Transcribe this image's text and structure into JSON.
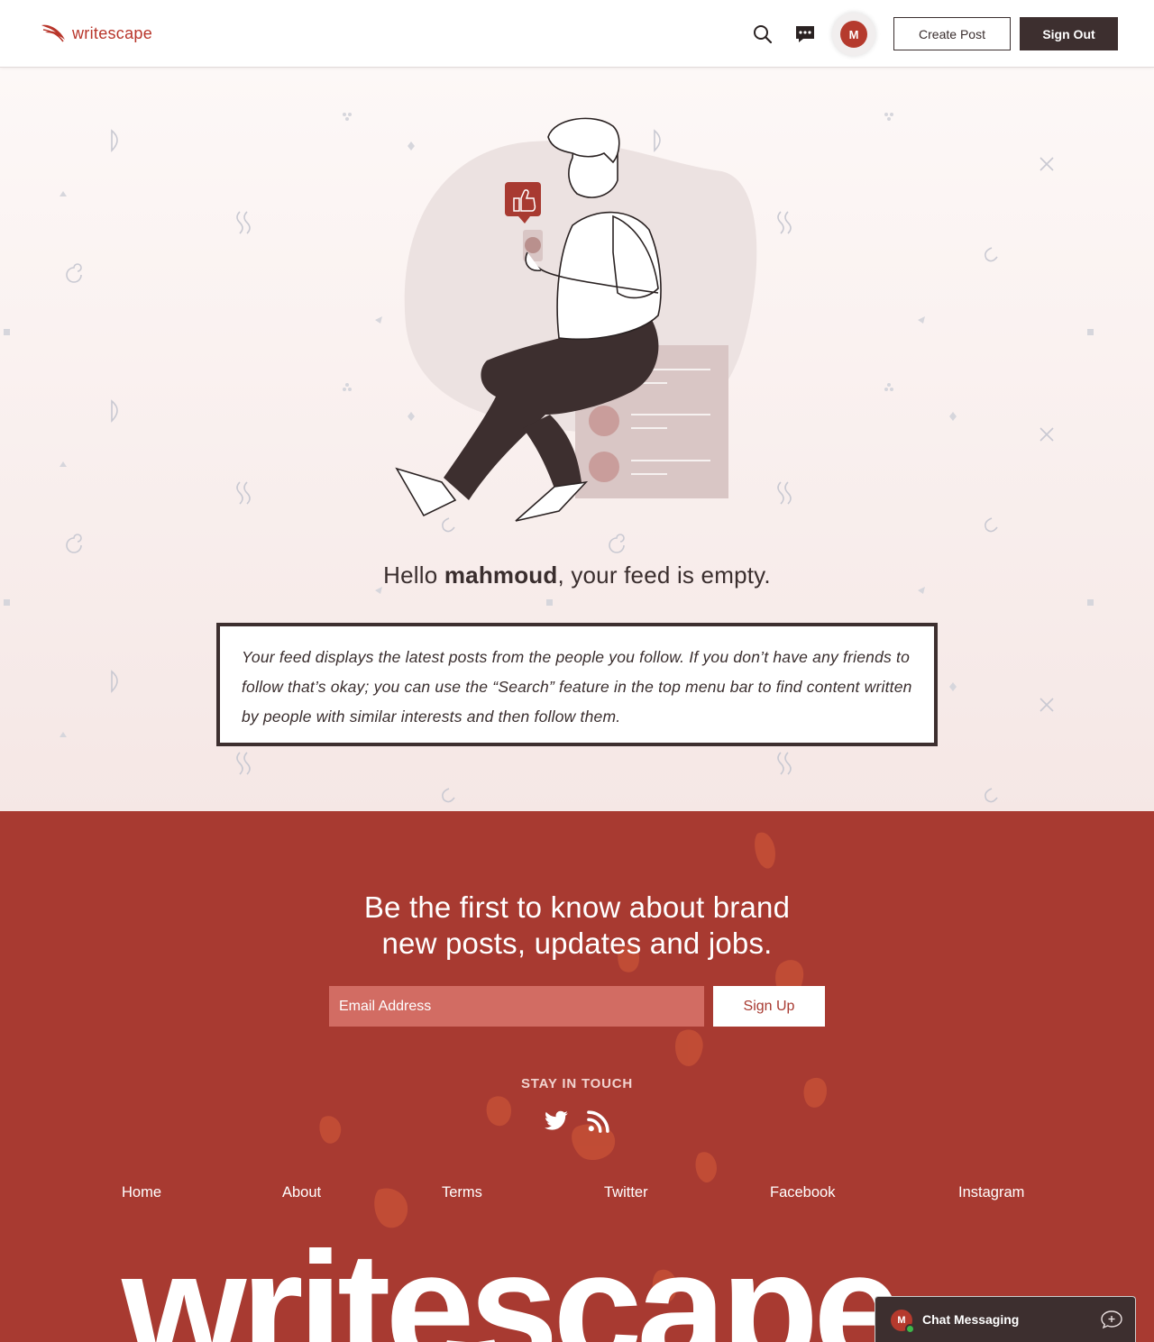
{
  "header": {
    "logo_text": "writescape",
    "avatar_initial": "M",
    "create_post_label": "Create Post",
    "sign_out_label": "Sign Out"
  },
  "feed": {
    "greeting_prefix": "Hello ",
    "username": "mahmoud",
    "greeting_suffix": ", your feed is empty.",
    "note": "Your feed displays the latest posts from the people you follow. If you don’t have any friends to follow that’s okay; you can use the “Search” feature in the top menu bar to find content written by people with similar interests and then follow them."
  },
  "newsletter": {
    "title_line1": "Be the first to know about brand",
    "title_line2": "new posts, updates and jobs.",
    "email_placeholder": "Email Address",
    "signup_label": "Sign Up"
  },
  "footer": {
    "stay_label": "STAY IN TOUCH",
    "nav": [
      "Home",
      "About",
      "Terms",
      "Twitter",
      "Facebook",
      "Instagram"
    ],
    "big_word": "writescape"
  },
  "chat": {
    "avatar_initial": "M",
    "label": "Chat Messaging"
  },
  "colors": {
    "brand": "#b8352a",
    "footer_bg": "#a83a31",
    "dark": "#3d2f2f",
    "online": "#3db84a"
  },
  "icons": [
    "feather-logo-icon",
    "search-icon",
    "chat-bubble-icon",
    "twitter-icon",
    "rss-icon",
    "new-message-icon",
    "thumbs-up-icon"
  ]
}
